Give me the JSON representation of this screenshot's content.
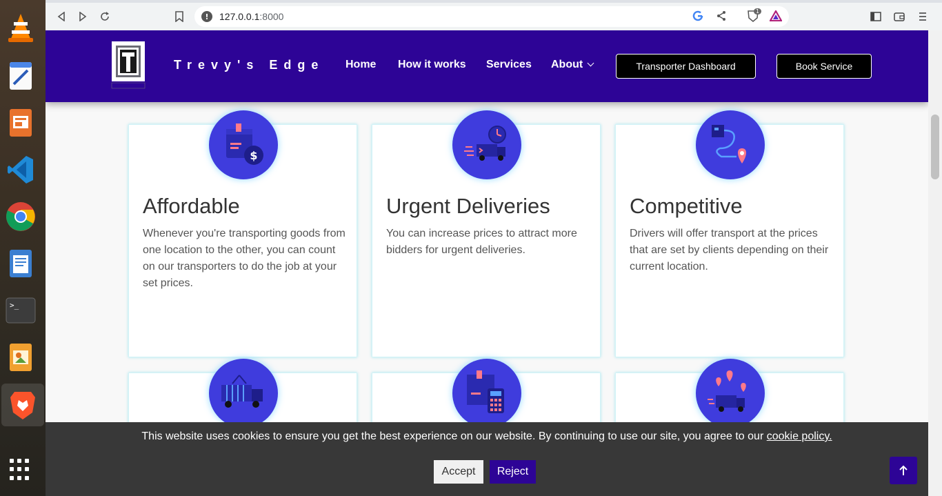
{
  "dock": {
    "items": [
      {
        "name": "vlc",
        "icon": "vlc-cone-icon"
      },
      {
        "name": "text-editor",
        "icon": "text-editor-icon"
      },
      {
        "name": "impress",
        "icon": "presentation-icon"
      },
      {
        "name": "vscode",
        "icon": "vscode-icon"
      },
      {
        "name": "chrome",
        "icon": "chrome-icon"
      },
      {
        "name": "writer",
        "icon": "writer-icon"
      },
      {
        "name": "terminal",
        "icon": "terminal-icon"
      },
      {
        "name": "image-viewer",
        "icon": "image-viewer-icon"
      },
      {
        "name": "brave",
        "icon": "brave-lion-icon"
      },
      {
        "name": "show-apps",
        "icon": "apps-grid-icon"
      }
    ]
  },
  "browser": {
    "url_host": "127.0.0.1",
    "url_port": ":8000",
    "notification_count": "1"
  },
  "navbar": {
    "logo_letter": "T",
    "brand": "Trevy's Edge",
    "links": [
      "Home",
      "How it works",
      "Services",
      "About"
    ],
    "dashboard_button": "Transporter Dashboard",
    "book_button": "Book Service"
  },
  "cards": [
    {
      "title": "Affordable",
      "text": "Whenever you're transporting goods from one location to the other, you can count on our transporters to do the job at your set prices.",
      "icon": "package-dollar-icon"
    },
    {
      "title": "Urgent Deliveries",
      "text": "You can increase prices to attract more bidders for urgent deliveries.",
      "icon": "fast-truck-clock-icon"
    },
    {
      "title": "Competitive",
      "text": "Drivers will offer transport at the prices that are set by clients depending on their current location.",
      "icon": "route-map-pin-icon"
    }
  ],
  "row2_icons": [
    "container-truck-icon",
    "package-calculator-icon",
    "truck-location-pins-icon"
  ],
  "cookie": {
    "message": "This website uses cookies to ensure you get the best experience on our website. By continuing to use our site, you agree to our",
    "link": "cookie policy.",
    "accept": "Accept",
    "reject": "Reject"
  },
  "colors": {
    "navbar": "#2d0496",
    "icon_circle": "#3f3cdd",
    "cookie_bar": "#383838",
    "reject_button": "#2d0496"
  }
}
